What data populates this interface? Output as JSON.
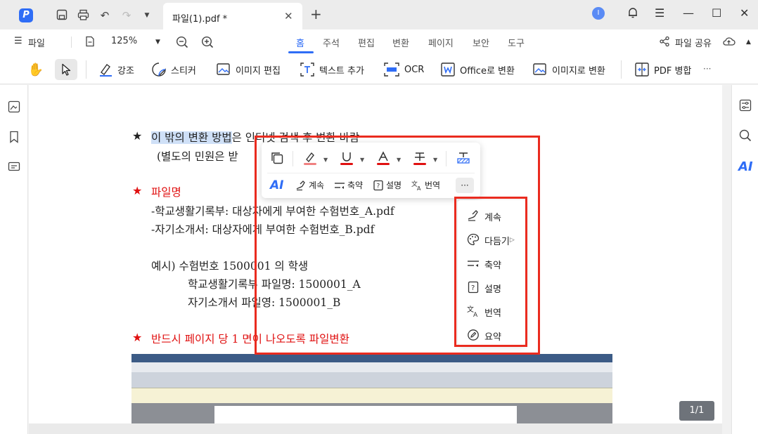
{
  "titlebar": {
    "tab_title": "파일(1).pdf *",
    "user_initial": "I"
  },
  "menu": {
    "file_label": "파일",
    "zoom": "125%",
    "tabs": [
      {
        "label": "홈",
        "active": true
      },
      {
        "label": "주석"
      },
      {
        "label": "편집"
      },
      {
        "label": "변환"
      },
      {
        "label": "페이지"
      },
      {
        "label": "보안"
      },
      {
        "label": "도구"
      }
    ],
    "share_label": "파일 공유"
  },
  "tools": {
    "highlight": "강조",
    "sticker": "스티커",
    "edit_image": "이미지 편집",
    "add_text": "텍스트 추가",
    "ocr": "OCR",
    "to_office": "Office로 변환",
    "to_image": "이미지로 변환",
    "merge_pdf": "PDF 병합",
    "more": "···"
  },
  "document": {
    "line1": "이 밖의 변환 방법은 인터넷 검색 후 변환 바람",
    "line1_highlight": "이 밖의 변환 방법",
    "line1_rest": "은 인터넷 검색 후 변환 바람",
    "line2": "(별도의 민원은 받",
    "heading1": "파일명",
    "item1": "-학교생활기록부: 대상자에게 부여한 수험번호_A.pdf",
    "item2": "-자기소개서: 대상자에게 부여한 수험번호_B.pdf",
    "example_line": "예시) 수험번호 1500001 의 학생",
    "example_a": "학교생활기록부 파일명: 1500001_A",
    "example_b": "자기소개서 파일영: 1500001_B",
    "heading2": "반드시 페이지 당 1 면이 나오도록 파일변환",
    "star": "★"
  },
  "float_toolbar": {
    "ai_label": "AI",
    "continue": "계속",
    "summarize": "축약",
    "explain": "설명",
    "translate": "번역",
    "more": "···"
  },
  "dropdown": {
    "items": [
      {
        "label": "계속",
        "icon": "pen-icon"
      },
      {
        "label": "다듬기",
        "icon": "palette-icon"
      },
      {
        "label": "축약",
        "icon": "shorten-icon"
      },
      {
        "label": "설명",
        "icon": "question-icon"
      },
      {
        "label": "번역",
        "icon": "translate-icon"
      },
      {
        "label": "요약",
        "icon": "edit-note-icon"
      }
    ]
  },
  "page_indicator": "1/1",
  "colors": {
    "accent": "#2f6df6",
    "highlight_box": "#ea2b1f",
    "doc_red": "#e01010"
  }
}
